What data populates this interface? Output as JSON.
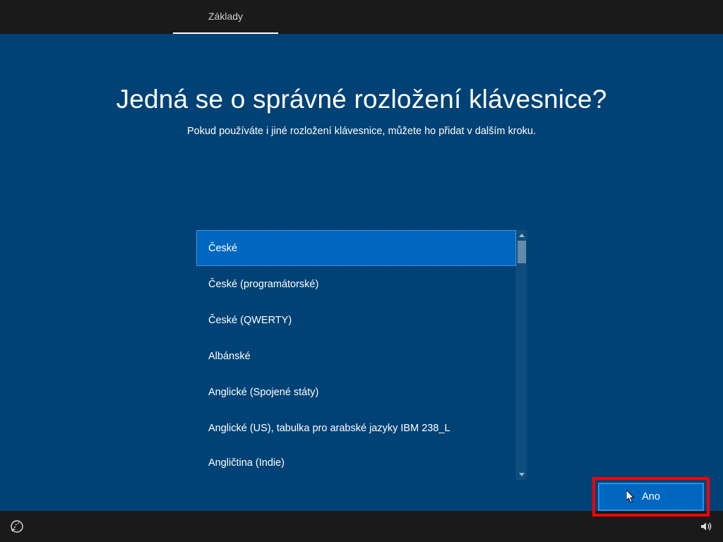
{
  "header": {
    "tab_label": "Základy"
  },
  "page": {
    "title": "Jedná se o správné rozložení klávesnice?",
    "subtitle": "Pokud používáte i jiné rozložení klávesnice, můžete ho přidat v dalším kroku."
  },
  "list": {
    "selected_index": 0,
    "items": [
      "České",
      "České (programátorské)",
      "České (QWERTY)",
      "Albánské",
      "Anglické (Spojené státy)",
      "Anglické (US), tabulka pro arabské jazyky IBM 238_L",
      "Angličtina (Indie)"
    ]
  },
  "buttons": {
    "confirm_label": "Ano"
  },
  "icons": {
    "accessibility": "ease-of-access-icon",
    "volume": "volume-icon"
  },
  "colors": {
    "background": "#004275",
    "accent": "#0067c0",
    "highlight_border": "#ff0000",
    "topbar": "#1a1a1a"
  }
}
